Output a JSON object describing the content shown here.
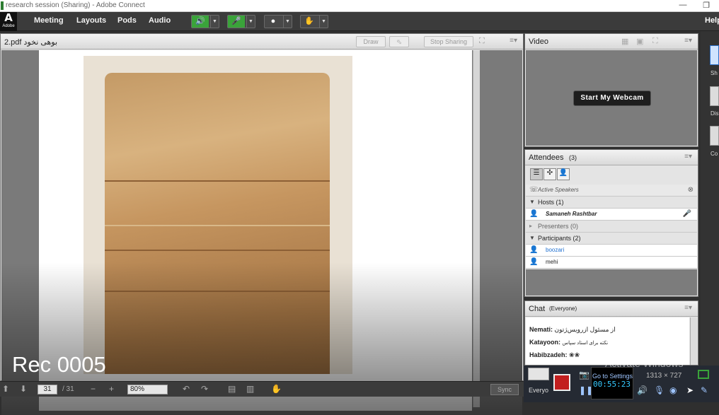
{
  "window": {
    "title": "research session (Sharing) - Adobe Connect",
    "minimize": "—",
    "restore": "❐"
  },
  "menubar": {
    "logo_glyph": "A",
    "logo_text": "Adobe",
    "items": [
      "Meeting",
      "Layouts",
      "Pods",
      "Audio"
    ],
    "help": "Help",
    "tools": [
      {
        "name": "speaker",
        "icon": "🔊"
      },
      {
        "name": "mic",
        "icon": "🎤"
      },
      {
        "name": "camera",
        "icon": "●"
      },
      {
        "name": "status",
        "icon": "✋"
      }
    ]
  },
  "share_pod": {
    "title": "2.pdf بوهی نخود",
    "draw_label": "Draw",
    "stop_label": "Stop Sharing",
    "rec_label": "Rec 0005",
    "page_current": "31",
    "page_total": "/ 31",
    "zoom": "80%",
    "sync_label": "Sync"
  },
  "video_pod": {
    "title": "Video",
    "webcam_button": "Start My Webcam"
  },
  "attendees_pod": {
    "title": "Attendees",
    "count": "(3)",
    "active_speakers": "Active Speakers",
    "hosts_label": "Hosts (1)",
    "host_name": "Samaneh Rashtbar",
    "presenters_label": "Presenters (0)",
    "participants_label": "Participants (2)",
    "participants": [
      "boozari",
      "mehi"
    ]
  },
  "chat_pod": {
    "title": "Chat",
    "scope": "(Everyone)",
    "messages": [
      {
        "sender": "Nemati:",
        "text": "از مسئول ازرویس‌ژتون"
      },
      {
        "sender": "Katayoon:",
        "text": "نکته برای استاد سپاس"
      },
      {
        "sender": "Habibzadeh:",
        "text": "❀❀"
      }
    ],
    "recipient": "Everyo"
  },
  "right_panel": {
    "labels": [
      "Sh",
      "Dis",
      "Co"
    ]
  },
  "overlay": {
    "activate": "Activate Windows",
    "settings": "Go to Settings",
    "resolution": "1313 × 727",
    "timer": "00:55:23"
  },
  "colors": {
    "accent_green": "#3aa33a",
    "host_red": "#c0282a",
    "participant_blue": "#1e6fd0"
  }
}
